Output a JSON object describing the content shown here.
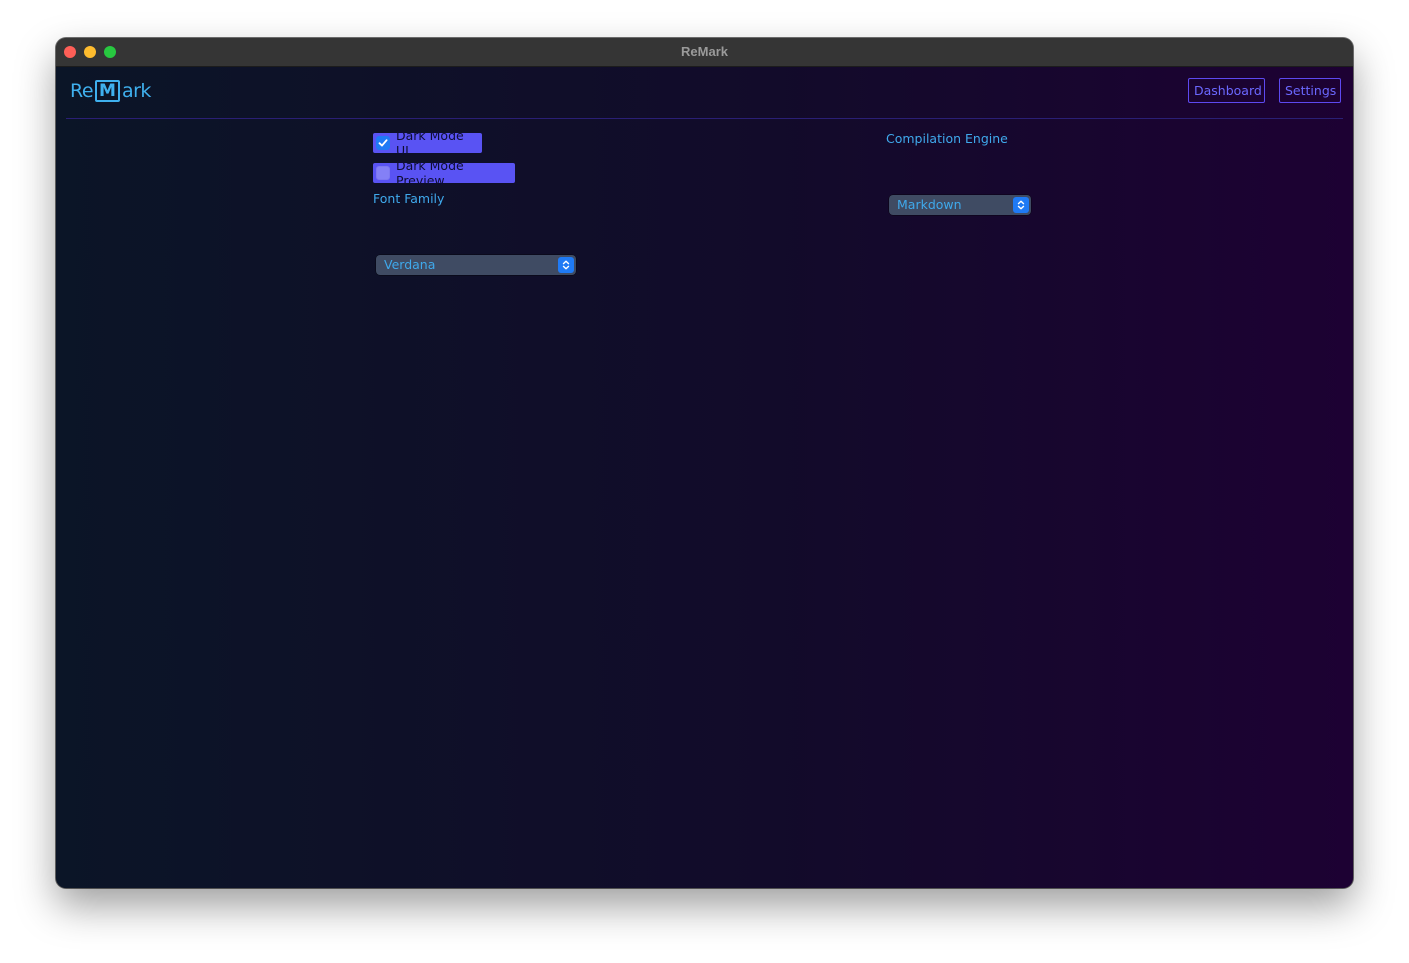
{
  "window": {
    "title": "ReMark"
  },
  "header": {
    "logo": {
      "part1": "Re",
      "part2": "M",
      "part3": "ark"
    },
    "nav": {
      "dashboard_label": "Dashboard",
      "settings_label": "Settings"
    }
  },
  "settings": {
    "dark_mode_ui": {
      "label": "Dark Mode UI",
      "checked": true
    },
    "dark_mode_preview": {
      "label": "Dark Mode Preview",
      "checked": false
    },
    "font_family": {
      "label": "Font Family",
      "value": "Verdana"
    },
    "compilation_engine": {
      "label": "Compilation Engine",
      "value": "Markdown"
    }
  },
  "icons": {
    "window_controls": [
      "close-icon",
      "minimize-icon",
      "maximize-icon"
    ],
    "checkmark": "checkmark-icon",
    "select_arrows": "chevron-updown-icon"
  },
  "colors": {
    "accent": "#5953f3",
    "link_blue": "#3fa9ec",
    "nav_border": "#5d49f0",
    "checkbox_blue": "#1f7af5",
    "bg_left": "#0b1527",
    "bg_right": "#1d0133"
  }
}
